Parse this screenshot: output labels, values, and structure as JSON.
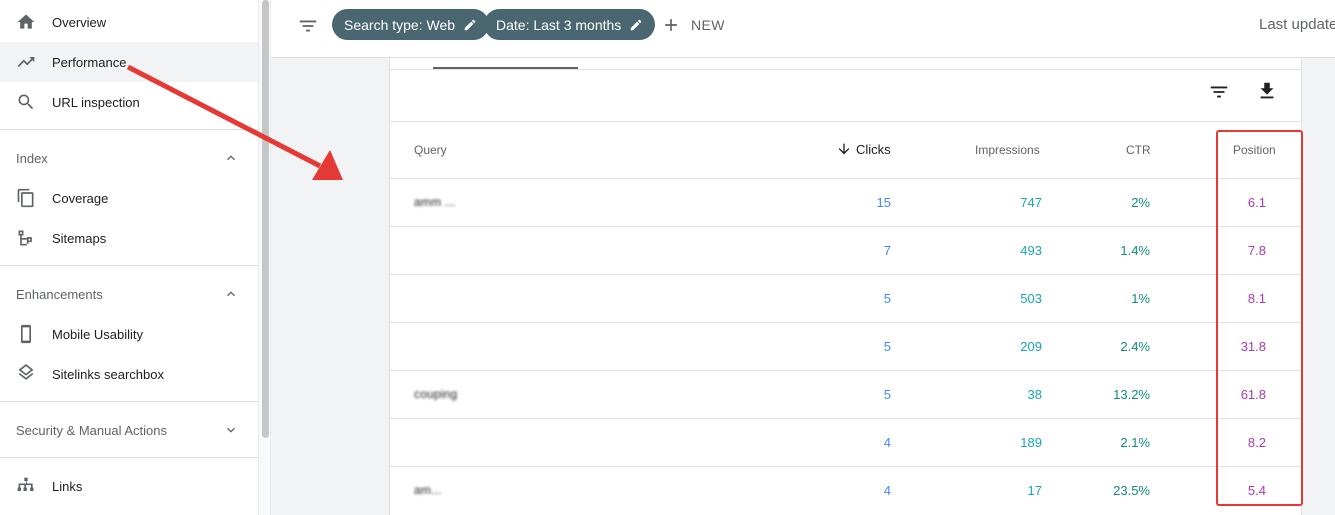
{
  "sidebar": {
    "items": [
      {
        "label": "Overview",
        "icon": "home-icon"
      },
      {
        "label": "Performance",
        "icon": "trending-icon"
      },
      {
        "label": "URL inspection",
        "icon": "search-icon"
      }
    ],
    "index": {
      "title": "Index",
      "items": [
        {
          "label": "Coverage"
        },
        {
          "label": "Sitemaps"
        }
      ]
    },
    "enhancements": {
      "title": "Enhancements",
      "items": [
        {
          "label": "Mobile Usability"
        },
        {
          "label": "Sitelinks searchbox"
        }
      ]
    },
    "security": {
      "title": "Security & Manual Actions"
    },
    "links": {
      "label": "Links"
    }
  },
  "topbar": {
    "chip_search": "Search type: Web",
    "chip_date": "Date: Last 3 months",
    "new_label": "NEW",
    "last_update": "Last update"
  },
  "table": {
    "headers": {
      "query": "Query",
      "clicks": "Clicks",
      "impressions": "Impressions",
      "ctr": "CTR",
      "position": "Position"
    },
    "rows": [
      {
        "query": "amm ... ",
        "clicks": "15",
        "impressions": "747",
        "ctr": "2%",
        "position": "6.1"
      },
      {
        "query": "",
        "clicks": "7",
        "impressions": "493",
        "ctr": "1.4%",
        "position": "7.8"
      },
      {
        "query": "",
        "clicks": "5",
        "impressions": "503",
        "ctr": "1%",
        "position": "8.1"
      },
      {
        "query": "",
        "clicks": "5",
        "impressions": "209",
        "ctr": "2.4%",
        "position": "31.8"
      },
      {
        "query": "couping",
        "clicks": "5",
        "impressions": "38",
        "ctr": "13.2%",
        "position": "61.8"
      },
      {
        "query": "",
        "clicks": "4",
        "impressions": "189",
        "ctr": "2.1%",
        "position": "8.2"
      },
      {
        "query": "am...",
        "clicks": "4",
        "impressions": "17",
        "ctr": "23.5%",
        "position": "5.4"
      }
    ]
  },
  "colors": {
    "chip": "#4a6670",
    "clicks": "#4285f4",
    "impressions": "#1aa3b8",
    "ctr": "#12897b",
    "position": "#a63ab5",
    "annotation": "#e53935"
  }
}
